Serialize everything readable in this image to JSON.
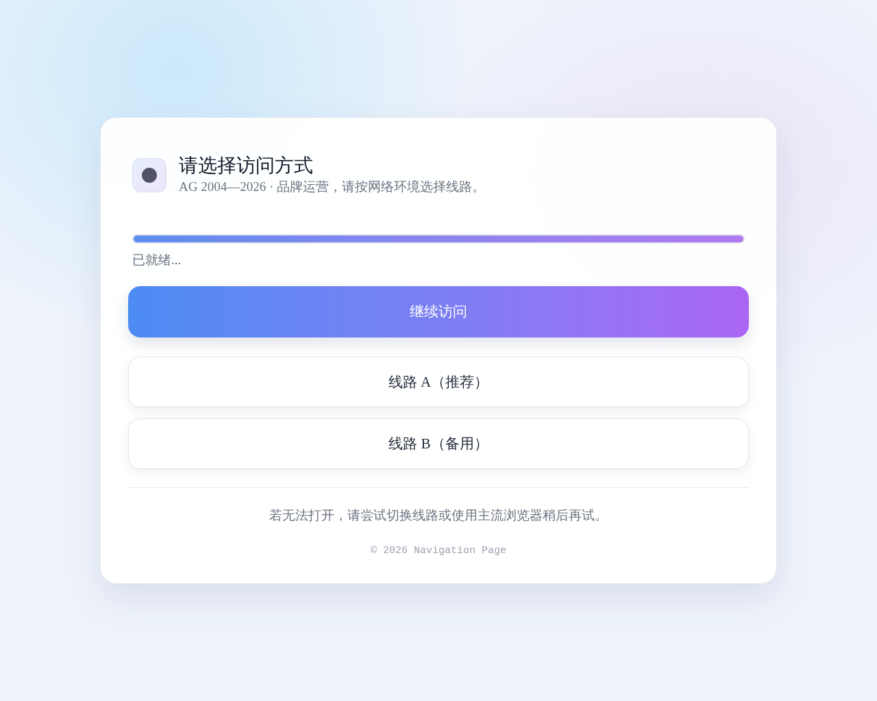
{
  "header": {
    "title": "请选择访问方式",
    "subtitle": "AG 2004—2026 · 品牌运营，请按网络环境选择线路。"
  },
  "progress": {
    "level": 1,
    "status": "已就绪..."
  },
  "buttons": [
    {
      "label": "继续访问",
      "kind": "primary"
    },
    {
      "label": "线路 A（推荐）",
      "kind": "secondary"
    },
    {
      "label": "线路 B（备用）",
      "kind": "secondary"
    }
  ],
  "footer": {
    "note": "若无法打开，请尝试切换线路或使用主流浏览器稍后再试。",
    "copyright": "© 2026 Navigation Page"
  }
}
